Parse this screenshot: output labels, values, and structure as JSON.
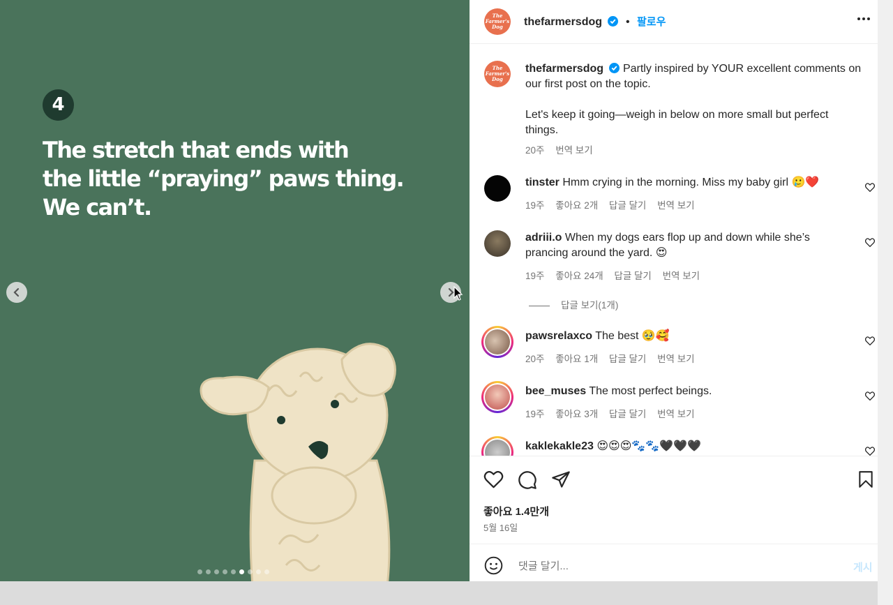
{
  "media": {
    "badge_number": "4",
    "headline_lines": [
      "The stretch that ends with",
      "the little “praying” paws thing.",
      "We can’t."
    ],
    "background_color": "#4a735b",
    "carousel": {
      "total_dots": 9,
      "active_index": 5
    }
  },
  "header": {
    "username": "thefarmersdog",
    "separator": "•",
    "follow_label": "팔로우",
    "logo_text": "The Farmer's Dog"
  },
  "caption": {
    "username": "thefarmersdog",
    "text_line1": "Partly inspired by YOUR excellent comments on our first post on the topic.",
    "text_line2": "Let's keep it going—weigh in below on more small but perfect things.",
    "age": "20주",
    "translate": "번역 보기"
  },
  "comments": [
    {
      "username": "tinster",
      "text": "Hmm crying in the morning. Miss my baby girl 🥲❤️",
      "age": "19주",
      "likes": "좋아요 2개",
      "reply": "답글 달기",
      "translate": "번역 보기"
    },
    {
      "username": "adriii.o",
      "text": "When my dogs ears flop up and down while she’s prancing around the yard. 😍",
      "age": "19주",
      "likes": "좋아요 24개",
      "reply": "답글 달기",
      "translate": "번역 보기",
      "view_replies": "답글 보기(1개)"
    },
    {
      "username": "pawsrelaxco",
      "text": "The best 🥹🥰",
      "age": "20주",
      "likes": "좋아요 1개",
      "reply": "답글 달기",
      "translate": "번역 보기"
    },
    {
      "username": "bee_muses",
      "text": "The most perfect beings.",
      "age": "19주",
      "likes": "좋아요 3개",
      "reply": "답글 달기",
      "translate": "번역 보기"
    },
    {
      "username": "kaklekakle23",
      "text": "😍😍😍🐾🐾🖤🖤🖤"
    }
  ],
  "actions": {
    "likes": "좋아요 1.4만개",
    "date": "5월 16일"
  },
  "add_comment": {
    "placeholder": "댓글 달기...",
    "post_label": "게시"
  },
  "colors": {
    "accent_blue": "#0095f6",
    "brand_orange": "#e8704e"
  }
}
